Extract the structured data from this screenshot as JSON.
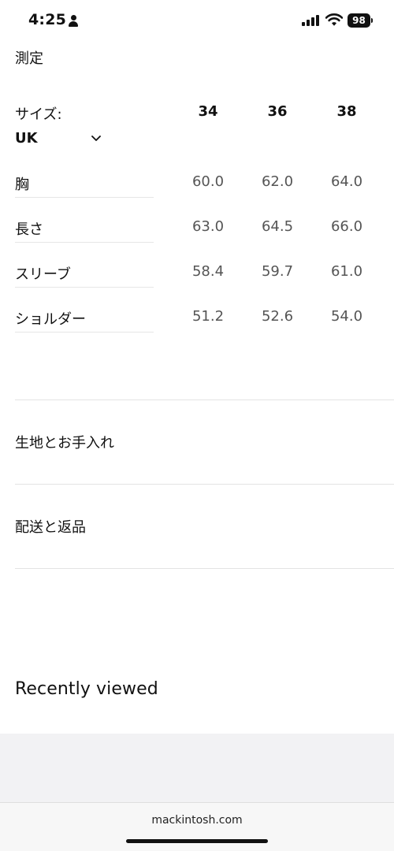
{
  "status_bar": {
    "time": "4:25",
    "battery": "98"
  },
  "measurements": {
    "title": "測定",
    "size_label": "サイズ:",
    "unit_selected": "UK",
    "sizes": [
      "34",
      "36",
      "38"
    ],
    "rows": [
      {
        "label": "胸",
        "values": [
          "60.0",
          "62.0",
          "64.0"
        ]
      },
      {
        "label": "長さ",
        "values": [
          "63.0",
          "64.5",
          "66.0"
        ]
      },
      {
        "label": "スリーブ",
        "values": [
          "58.4",
          "59.7",
          "61.0"
        ]
      },
      {
        "label": "ショルダー",
        "values": [
          "51.2",
          "52.6",
          "54.0"
        ]
      }
    ]
  },
  "sections": {
    "fabric_care": "生地とお手入れ",
    "shipping_returns": "配送と返品"
  },
  "recently_viewed": {
    "title": "Recently viewed"
  },
  "browser": {
    "url": "mackintosh.com"
  },
  "colors": {
    "text": "#111111",
    "value_text": "#555555",
    "divider": "#e3e3e3"
  }
}
